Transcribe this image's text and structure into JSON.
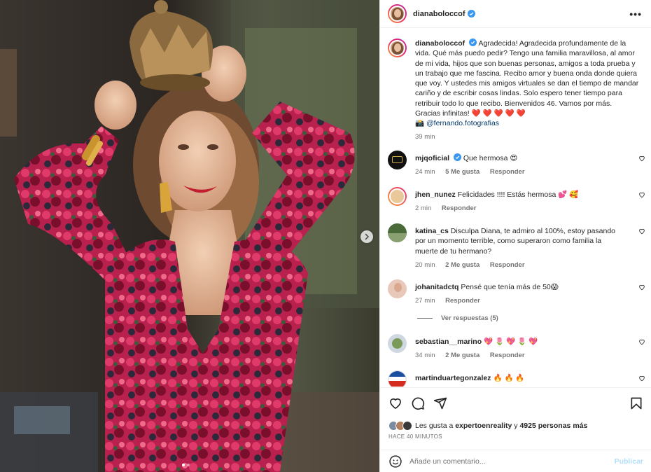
{
  "post": {
    "username": "dianaboloccof",
    "caption": "Agradecida! Agradecida profundamente de la vida. Qué más puedo pedir? Tengo una familia maravillosa, al amor de mi vida, hijos que son buenas personas, amigos a toda prueba y un trabajo que me fascina. Recibo amor y buena onda donde quiera que voy. Y ustedes mis amigos virtuales se dan el tiempo de mandar cariño y de escribir cosas lindas. Solo espero tener tiempo para retribuir todo lo que recibo. Bienvenidos 46. Vamos por más. Gracias infinitas!",
    "caption_emojis": "❤️ ❤️ ❤️ ❤️ ❤️",
    "camera_emoji": "📸",
    "mention": "@fernando.fotografias",
    "time": "39 min"
  },
  "comments": [
    {
      "user": "mjqoficial",
      "text": "Que hermosa 😍",
      "time": "24 min",
      "likes": "5 Me gusta",
      "reply": "Responder"
    },
    {
      "user": "jhen_nunez",
      "text": "Felicidades !!!! Estás hermosa 💕 🥰",
      "time": "2 min",
      "likes": "",
      "reply": "Responder"
    },
    {
      "user": "katina_cs",
      "text": "Disculpa Diana, te admiro al 100%, estoy pasando por un momento terrible, como superaron como familia la muerte de tu hermano?",
      "time": "20 min",
      "likes": "2 Me gusta",
      "reply": "Responder"
    },
    {
      "user": "johanitadctq",
      "text": "Pensé que tenía más de 50😱",
      "time": "27 min",
      "likes": "",
      "reply": "Responder",
      "view_replies": "Ver respuestas (5)"
    },
    {
      "user": "sebastian__marino",
      "text": "💖 🌷 💖 🌷 💖",
      "time": "34 min",
      "likes": "2 Me gusta",
      "reply": "Responder"
    },
    {
      "user": "martinduartegonzalez",
      "text": "🔥 🔥 🔥",
      "time": "",
      "likes": "",
      "reply": ""
    }
  ],
  "likes_prefix": "Les gusta a",
  "likes_user": "expertoenreality",
  "likes_conj": "y",
  "likes_count": "4925 personas más",
  "posted_ago": "HACE 40 MINUTOS",
  "comment_placeholder": "Añade un comentario...",
  "publish_label": "Publicar",
  "colors": {
    "accent": "#0095f6",
    "publish_disabled": "#b2dffc",
    "link": "#00376b",
    "verified": "#3897f0"
  },
  "icons": [
    "next-arrow-icon",
    "verified-icon",
    "more-options-icon",
    "heart-icon",
    "comment-icon",
    "share-icon",
    "save-icon",
    "emoji-icon"
  ]
}
